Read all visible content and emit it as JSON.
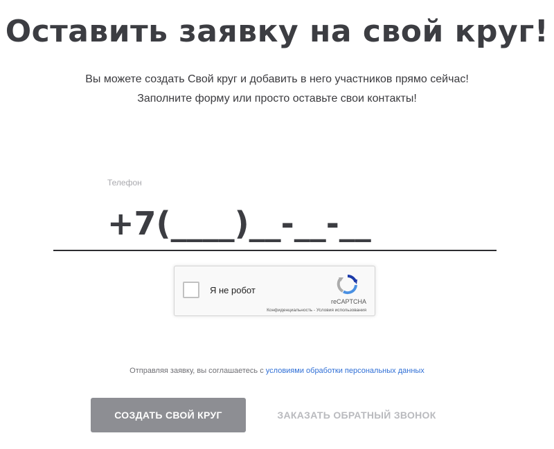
{
  "header": {
    "title": "Оставить заявку на свой круг!",
    "subtitle_line1": "Вы можете создать Свой круг и добавить в него участников прямо сейчас!",
    "subtitle_line2": "Заполните форму или просто оставьте свои контакты!"
  },
  "form": {
    "phone_label": "Телефон",
    "phone_placeholder": "+7(____)__-__-__"
  },
  "captcha": {
    "checkbox_label": "Я не робот",
    "brand": "reCAPTCHA",
    "privacy_link": "Конфиденциальность",
    "separator": " - ",
    "terms_link": "Условия использования",
    "checked": false
  },
  "consent": {
    "text": "Отправляя заявку, вы соглашаетесь с ",
    "link_text": "условиями обработки персональных данных"
  },
  "actions": {
    "primary_label": "СОЗДАТЬ СВОЙ КРУГ",
    "secondary_label": "ЗАКАЗАТЬ ОБРАТНЫЙ ЗВОНОК"
  },
  "colors": {
    "title": "#3c3d42",
    "primary_button": "#8d8e93",
    "secondary_text": "#b9babe",
    "link": "#2f6fd6"
  },
  "icons": {
    "captcha_logo": "recaptcha-icon"
  }
}
